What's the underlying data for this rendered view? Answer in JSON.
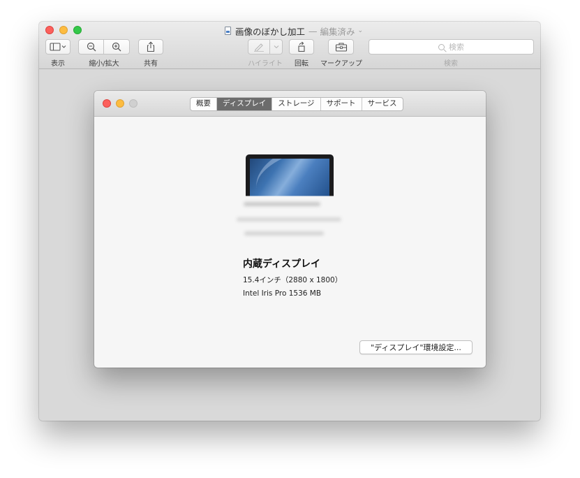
{
  "preview": {
    "title": "画像のぼかし加工",
    "title_separator": "—",
    "title_state": "編集済み",
    "title_chevron": "⌄",
    "toolbar": {
      "view_label": "表示",
      "zoom_label": "縮小/拡大",
      "share_label": "共有",
      "highlight_label": "ハイライト",
      "rotate_label": "回転",
      "markup_label": "マークアップ",
      "search_label": "検索",
      "search_placeholder": "検索"
    }
  },
  "about_window": {
    "tabs": [
      {
        "label": "概要"
      },
      {
        "label": "ディスプレイ",
        "active": true
      },
      {
        "label": "ストレージ"
      },
      {
        "label": "サポート"
      },
      {
        "label": "サービス"
      }
    ],
    "display_name": "内蔵ディスプレイ",
    "display_size": "15.4インチ（2880 x 1800）",
    "display_gpu": "Intel Iris Pro 1536 MB",
    "prefs_button_label": "\"ディスプレイ\"環境設定..."
  },
  "colors": {
    "close": "#fc605c",
    "minimize": "#fdbc40",
    "zoom": "#34c84a",
    "active_tab": "#6c6c6c"
  },
  "icons": [
    "sidebar-icon",
    "zoom-out-icon",
    "zoom-in-icon",
    "share-icon",
    "pen-icon",
    "rotate-icon",
    "toolbox-icon",
    "search-icon",
    "document-icon"
  ]
}
